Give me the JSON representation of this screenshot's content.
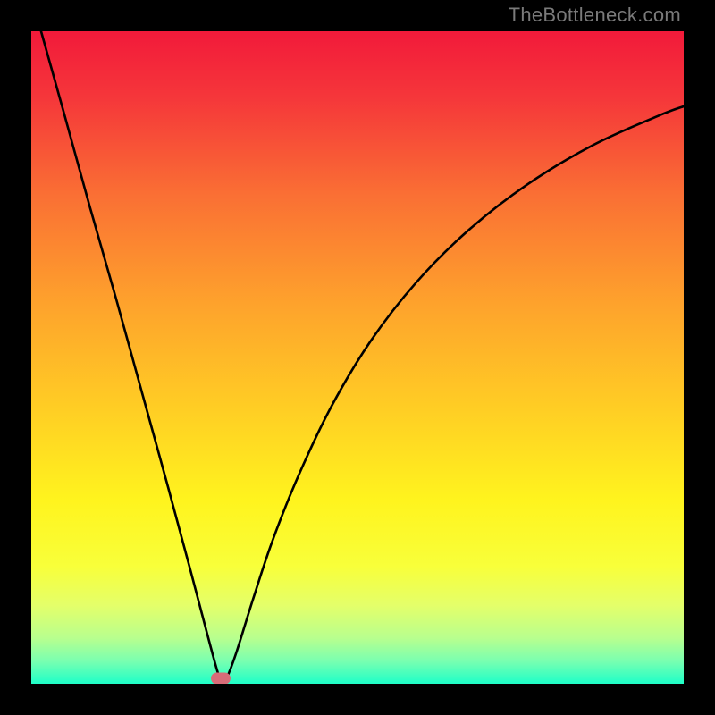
{
  "watermark": "TheBottleneck.com",
  "gradient_stops": [
    {
      "offset": 0.0,
      "color": "#f21a3a"
    },
    {
      "offset": 0.1,
      "color": "#f5363a"
    },
    {
      "offset": 0.25,
      "color": "#fa6f34"
    },
    {
      "offset": 0.42,
      "color": "#fea32c"
    },
    {
      "offset": 0.58,
      "color": "#ffce24"
    },
    {
      "offset": 0.72,
      "color": "#fff41e"
    },
    {
      "offset": 0.82,
      "color": "#f8ff3a"
    },
    {
      "offset": 0.88,
      "color": "#e4ff6a"
    },
    {
      "offset": 0.93,
      "color": "#b8ff8e"
    },
    {
      "offset": 0.965,
      "color": "#7affb0"
    },
    {
      "offset": 1.0,
      "color": "#1effc8"
    }
  ],
  "marker": {
    "x_frac": 0.29,
    "y_frac": 0.992
  },
  "chart_data": {
    "type": "line",
    "title": "",
    "xlabel": "",
    "ylabel": "",
    "xlim": [
      0,
      1
    ],
    "ylim": [
      0,
      1
    ],
    "note": "Values below are (x, y) pairs as fractions of the plot area; y measured from top (0) to bottom (1). The curve is the bottleneck V-shape with minimum near x≈0.29.",
    "series": [
      {
        "name": "bottleneck-curve",
        "points": [
          [
            0.015,
            0.0
          ],
          [
            0.05,
            0.125
          ],
          [
            0.09,
            0.27
          ],
          [
            0.13,
            0.41
          ],
          [
            0.17,
            0.555
          ],
          [
            0.21,
            0.7
          ],
          [
            0.245,
            0.83
          ],
          [
            0.27,
            0.925
          ],
          [
            0.285,
            0.98
          ],
          [
            0.292,
            0.998
          ],
          [
            0.3,
            0.99
          ],
          [
            0.315,
            0.95
          ],
          [
            0.34,
            0.87
          ],
          [
            0.37,
            0.78
          ],
          [
            0.41,
            0.68
          ],
          [
            0.46,
            0.575
          ],
          [
            0.52,
            0.475
          ],
          [
            0.59,
            0.385
          ],
          [
            0.67,
            0.305
          ],
          [
            0.76,
            0.235
          ],
          [
            0.86,
            0.175
          ],
          [
            0.96,
            0.13
          ],
          [
            1.0,
            0.115
          ]
        ]
      }
    ]
  }
}
